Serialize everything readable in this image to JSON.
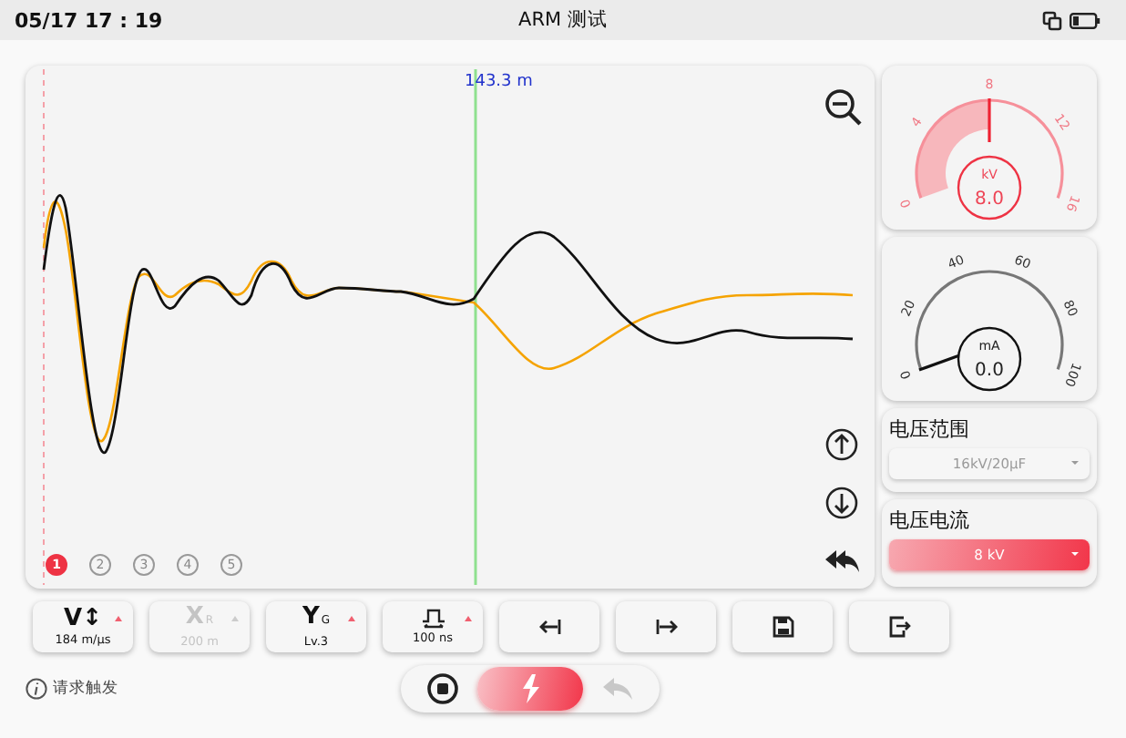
{
  "status_bar": {
    "time": "05/17 17 : 19",
    "title": "ARM 测试"
  },
  "waveform": {
    "cursor_label": "143.3 m",
    "channels": [
      {
        "label": "1",
        "selected": true
      },
      {
        "label": "2",
        "selected": false
      },
      {
        "label": "3",
        "selected": false
      },
      {
        "label": "4",
        "selected": false
      },
      {
        "label": "5",
        "selected": false
      }
    ]
  },
  "gauges": [
    {
      "kind": "filled",
      "unit": "kV",
      "reading": "8.0",
      "ticks": [
        "0",
        "4",
        "8",
        "12",
        "16"
      ]
    },
    {
      "kind": "needle",
      "unit": "mA",
      "reading": "0.0",
      "ticks": [
        "0",
        "20",
        "40",
        "60",
        "80",
        "100"
      ]
    }
  ],
  "selectors": [
    {
      "title": "电压范围",
      "value": "16kV/20μF",
      "disabled": true
    },
    {
      "title": "电压电流",
      "value": "8 kV",
      "disabled": false
    }
  ],
  "toolbar": [
    {
      "kind": "param",
      "label": "V↕",
      "value": "184 m/μs",
      "disabled": false
    },
    {
      "kind": "param",
      "label": "X",
      "sub": "R",
      "value": "200 m",
      "disabled": true
    },
    {
      "kind": "param",
      "label": "Y",
      "sub": "G",
      "value": "Lv.3",
      "disabled": false
    },
    {
      "kind": "pulse",
      "value": "100 ns",
      "disabled": false
    },
    {
      "kind": "icon"
    },
    {
      "kind": "icon"
    },
    {
      "kind": "icon"
    },
    {
      "kind": "icon"
    }
  ],
  "trigger_hint": "请求触发",
  "controls": [
    {
      "selected": false,
      "disabled": false
    },
    {
      "selected": true,
      "disabled": false
    },
    {
      "selected": false,
      "disabled": true
    }
  ]
}
